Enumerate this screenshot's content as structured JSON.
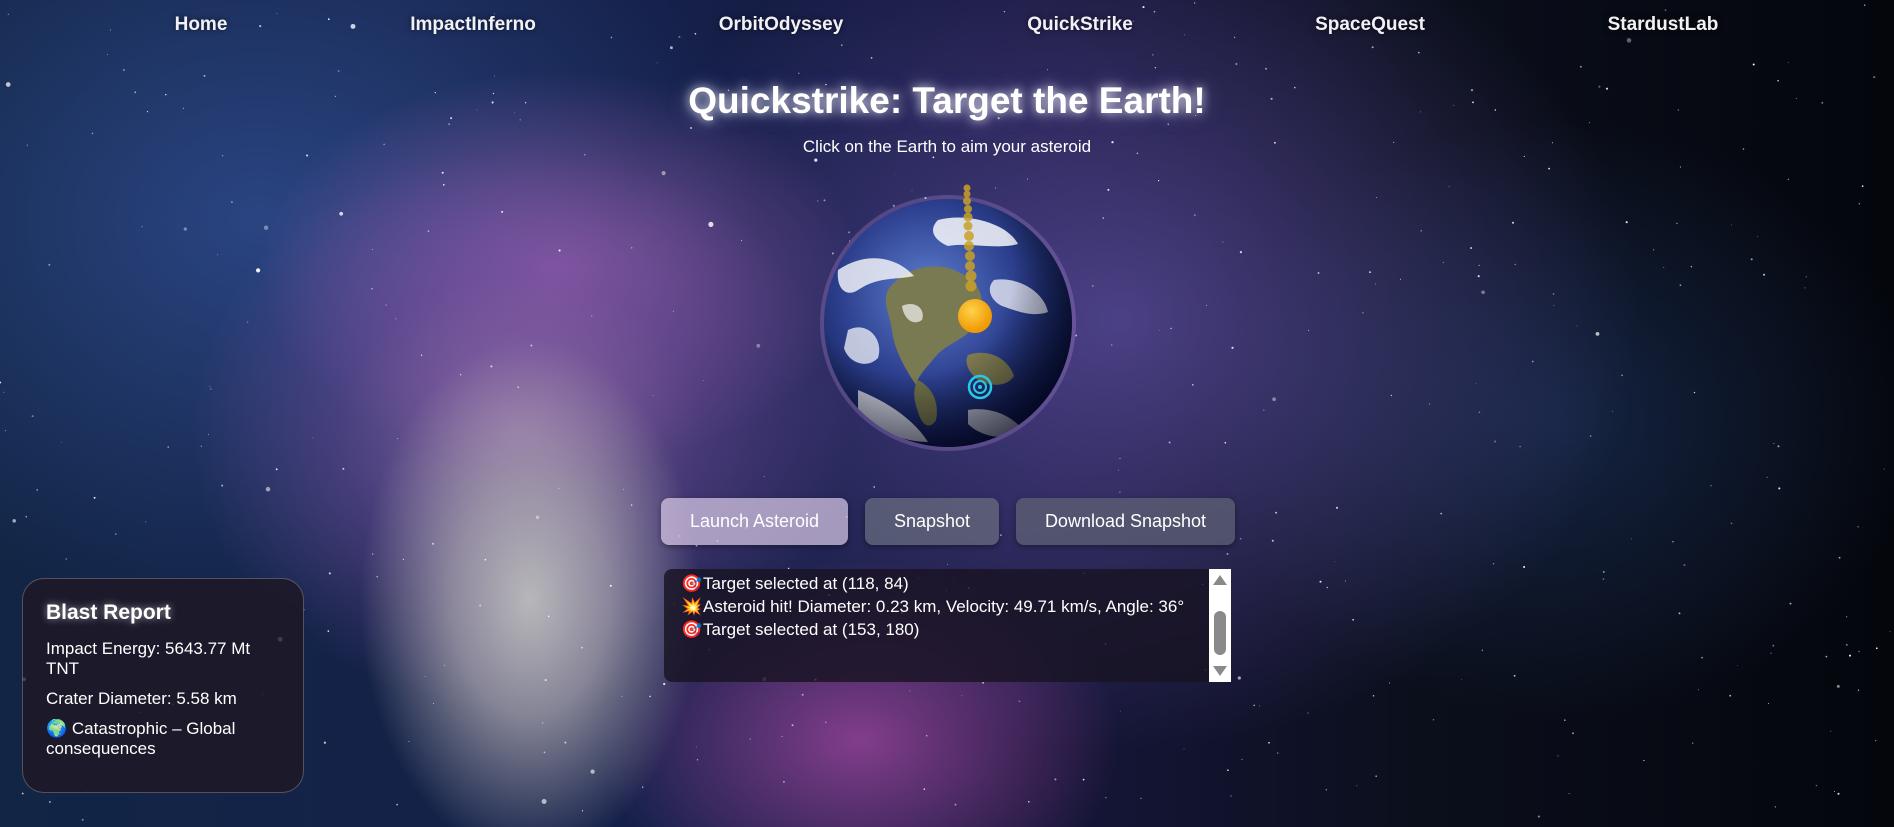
{
  "nav": {
    "items": [
      {
        "label": "Home"
      },
      {
        "label": "ImpactInferno"
      },
      {
        "label": "OrbitOdyssey"
      },
      {
        "label": "QuickStrike"
      },
      {
        "label": "SpaceQuest"
      },
      {
        "label": "StardustLab"
      }
    ]
  },
  "header": {
    "title": "Quickstrike: Target the Earth!",
    "subtitle": "Click on the Earth to aim your asteroid"
  },
  "canvas": {
    "earth_icon": "earth-globe",
    "asteroid_icon": "asteroid-orange-ball",
    "target_icon": "target-reticle"
  },
  "buttons": {
    "launch": "Launch Asteroid",
    "snapshot": "Snapshot",
    "download": "Download Snapshot"
  },
  "log": {
    "entries": [
      {
        "icon": "🎯",
        "text": "Target selected at (118, 84)"
      },
      {
        "icon": "💥",
        "text": "Asteroid hit! Diameter: 0.23 km, Velocity: 49.71 km/s, Angle: 36°"
      },
      {
        "icon": "🎯",
        "text": "Target selected at (153, 180)"
      }
    ]
  },
  "report": {
    "title": "Blast Report",
    "energy": "Impact Energy: 5643.77 Mt TNT",
    "crater": "Crater Diameter: 5.58 km",
    "severity_icon": "🌍",
    "severity": "Catastrophic – Global consequences"
  },
  "colors": {
    "asteroid": "#f7a90b",
    "trail": "#c9a227",
    "target": "#28c9e8"
  }
}
